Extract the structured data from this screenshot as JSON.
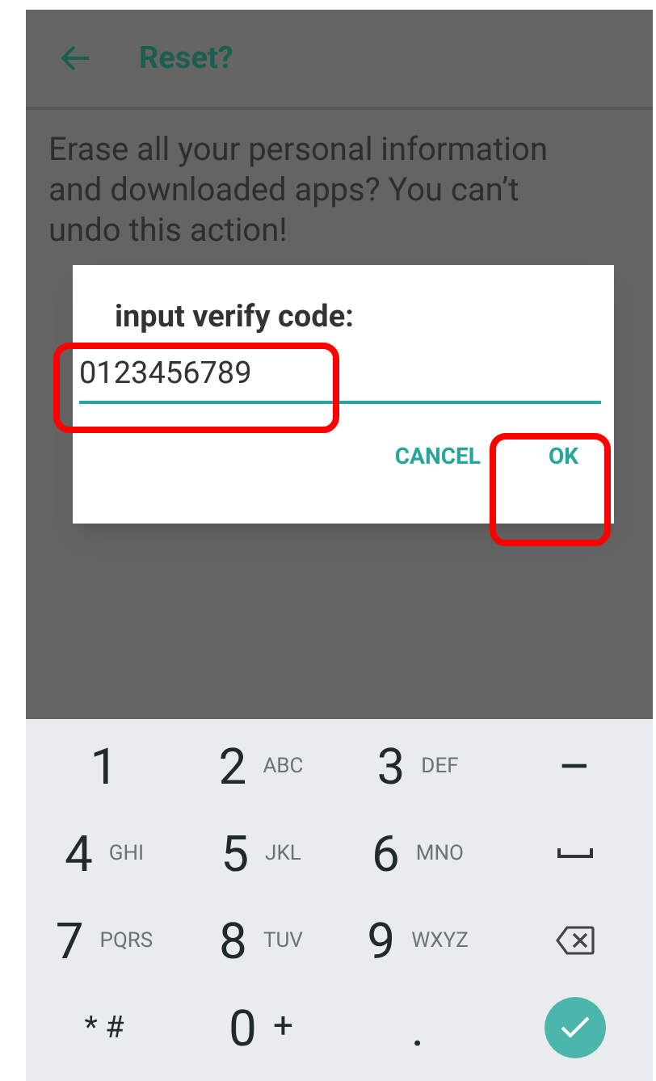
{
  "app_bar": {
    "title": "Reset?"
  },
  "message": "Erase all your personal information and downloaded apps? You can’t undo this action!",
  "dialog": {
    "title": "input verify code:",
    "field": {
      "value": "0123456789"
    },
    "buttons": [
      "CANCEL",
      "OK"
    ]
  },
  "keypad": [
    {
      "kind": "key",
      "main": "1"
    },
    {
      "kind": "key",
      "main": "2",
      "sub": "ABC"
    },
    {
      "kind": "key",
      "main": "3",
      "sub": "DEF"
    },
    {
      "kind": "key",
      "main": "–"
    },
    {
      "kind": "key",
      "main": "4",
      "sub": "GHI"
    },
    {
      "kind": "key",
      "main": "5",
      "sub": "JKL"
    },
    {
      "kind": "key",
      "main": "6",
      "sub": "MNO"
    },
    {
      "kind": "space"
    },
    {
      "kind": "key",
      "main": "7",
      "sub": "PQRS"
    },
    {
      "kind": "key",
      "main": "8",
      "sub": "TUV"
    },
    {
      "kind": "key",
      "main": "9",
      "sub": "WXYZ"
    },
    {
      "kind": "backspace"
    },
    {
      "kind": "symbol",
      "main": "* #"
    },
    {
      "kind": "key",
      "main": "0",
      "sub": "+"
    },
    {
      "kind": "key",
      "main": "."
    },
    {
      "kind": "done"
    }
  ]
}
